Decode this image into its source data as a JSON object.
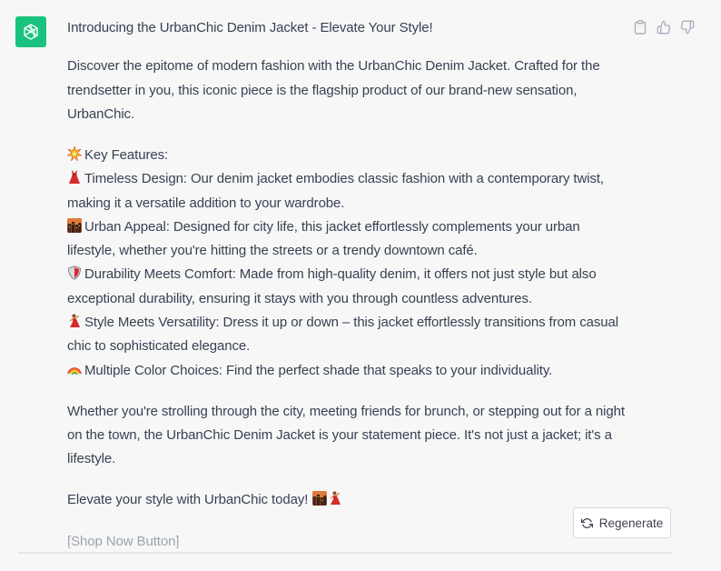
{
  "message": {
    "title": "Introducing the UrbanChic Denim Jacket - Elevate Your Style!",
    "intro": "Discover the epitome of modern fashion with the UrbanChic Denim Jacket. Crafted for the trendsetter in you, this iconic piece is the flagship product of our brand-new sensation, UrbanChic.",
    "features_heading": "Key Features:",
    "features": [
      {
        "icon": "dress-emoji",
        "text": "Timeless Design: Our denim jacket embodies classic fashion with a contemporary twist, making it a versatile addition to your wardrobe."
      },
      {
        "icon": "city-sunset-emoji",
        "text": "Urban Appeal: Designed for city life, this jacket effortlessly complements your urban lifestyle, whether you're hitting the streets or a trendy downtown café."
      },
      {
        "icon": "shield-emoji",
        "text": "Durability Meets Comfort: Made from high-quality denim, it offers not just style but also exceptional durability, ensuring it stays with you through countless adventures."
      },
      {
        "icon": "dancer-emoji",
        "text": "Style Meets Versatility: Dress it up or down – this jacket effortlessly transitions from casual chic to sophisticated elegance."
      },
      {
        "icon": "rainbow-emoji",
        "text": "Multiple Color Choices: Find the perfect shade that speaks to your individuality."
      }
    ],
    "closing": "Whether you're strolling through the city, meeting friends for brunch, or stepping out for a night on the town, the UrbanChic Denim Jacket is your statement piece. It's not just a jacket; it's a lifestyle.",
    "cta": "Elevate your style with UrbanChic today!",
    "shop_button": "[Shop Now Button]"
  },
  "regenerate_label": "Regenerate",
  "colors": {
    "avatar": "#19c37d",
    "background": "#f7f7f8",
    "text": "#374151"
  }
}
